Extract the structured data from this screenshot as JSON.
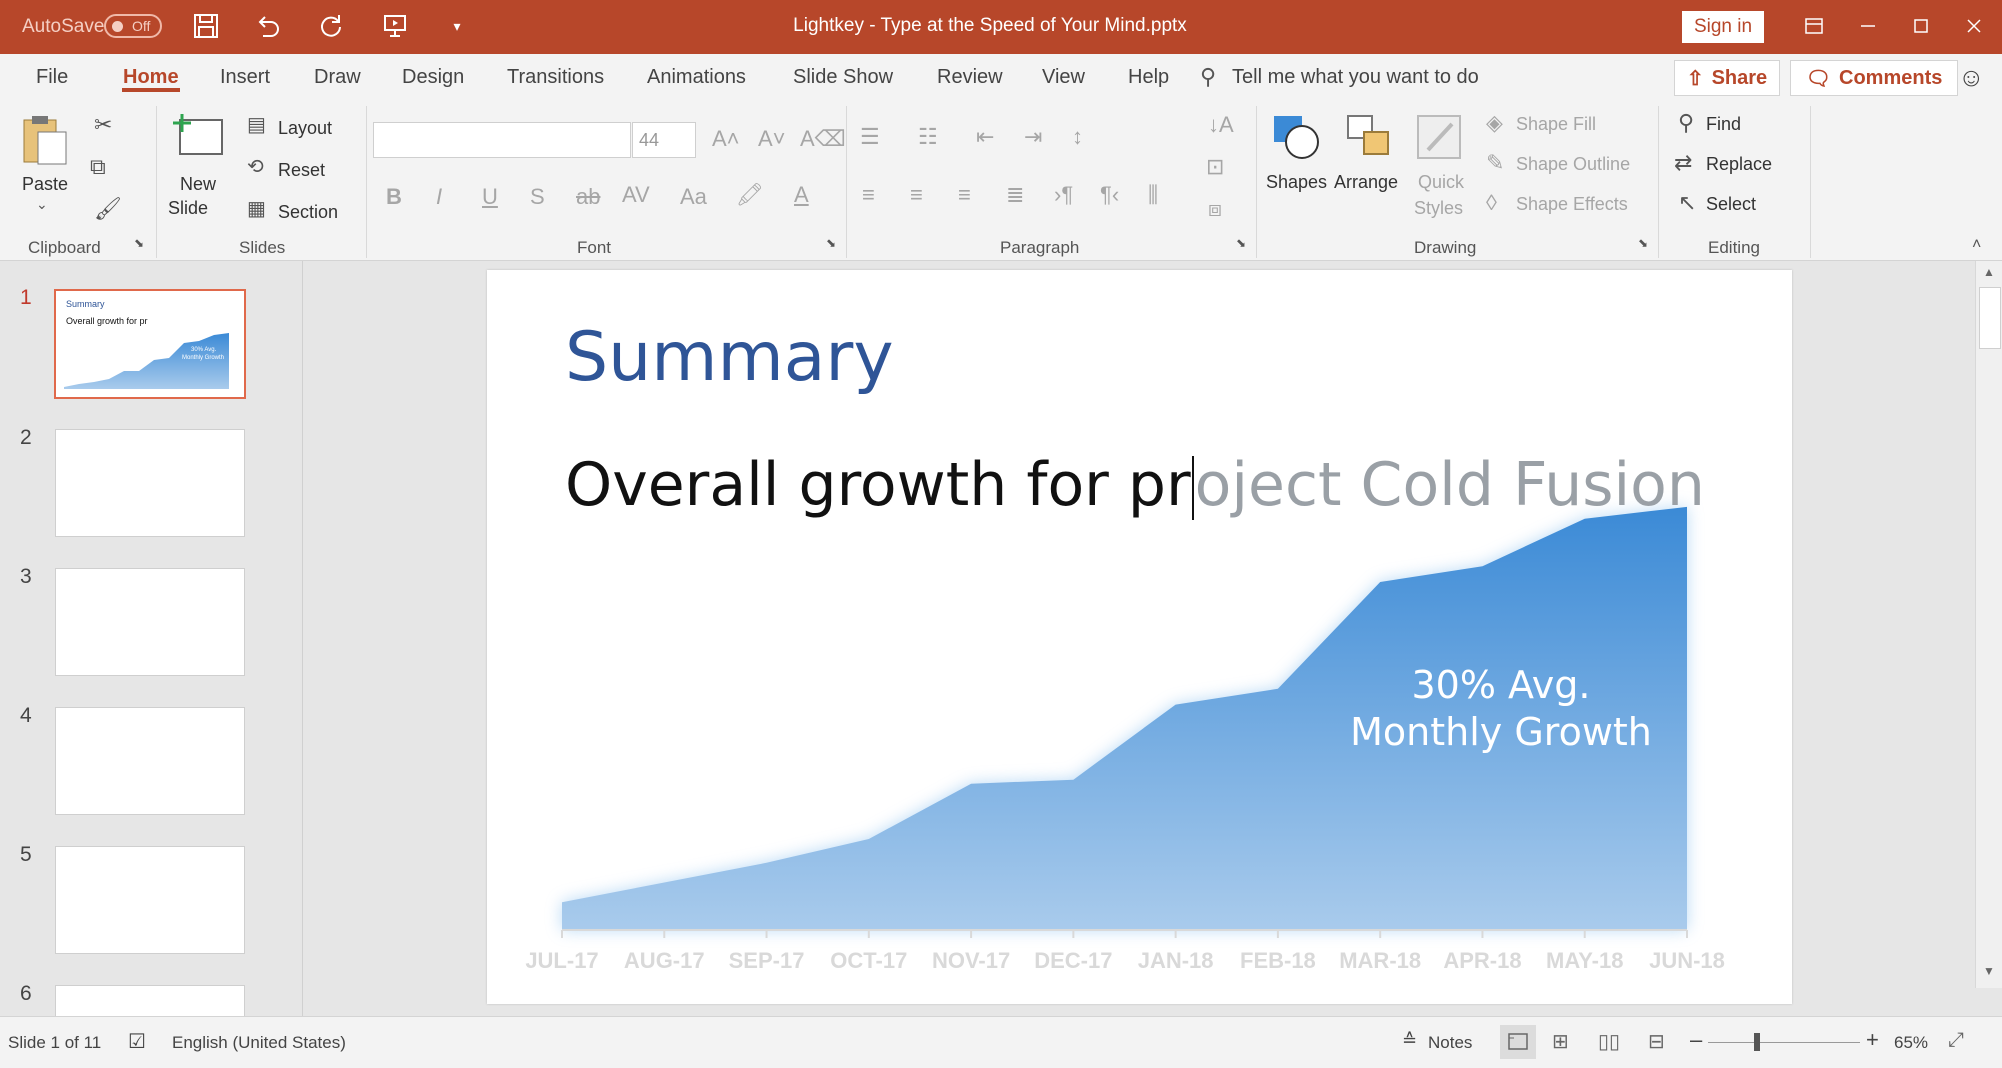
{
  "titlebar": {
    "autosave_label": "AutoSave",
    "autosave_state": "Off",
    "doc_title": "Lightkey - Type at the Speed of Your Mind.pptx",
    "sign_in": "Sign in"
  },
  "ribbon": {
    "tabs": [
      "File",
      "Home",
      "Insert",
      "Draw",
      "Design",
      "Transitions",
      "Animations",
      "Slide Show",
      "Review",
      "View",
      "Help"
    ],
    "active_tab": "Home",
    "tell_me": "Tell me what you want to do",
    "share": "Share",
    "comments": "Comments",
    "groups": {
      "clipboard": "Clipboard",
      "slides": "Slides",
      "font": "Font",
      "paragraph": "Paragraph",
      "drawing": "Drawing",
      "editing": "Editing"
    },
    "paste": "Paste",
    "new_slide_1": "New",
    "new_slide_2": "Slide",
    "layout": "Layout",
    "reset": "Reset",
    "section": "Section",
    "font_size": "44",
    "shapes": "Shapes",
    "arrange": "Arrange",
    "quick_styles_1": "Quick",
    "quick_styles_2": "Styles",
    "shape_fill": "Shape Fill",
    "shape_outline": "Shape Outline",
    "shape_effects": "Shape Effects",
    "find": "Find",
    "replace": "Replace",
    "select": "Select"
  },
  "thumbnails": {
    "numbers": [
      "1",
      "2",
      "3",
      "4",
      "5",
      "6"
    ],
    "t1_title": "Summary",
    "t1_sub": "Overall growth for pr",
    "t1_note_1": "30% Avg.",
    "t1_note_2": "Monthly Growth"
  },
  "slide": {
    "title": "Summary",
    "subtitle_typed": "Overall growth for pr",
    "subtitle_suggestion": "oject Cold Fusion",
    "chart_note_1": "30% Avg.",
    "chart_note_2": "Monthly Growth"
  },
  "chart_data": {
    "type": "area",
    "categories": [
      "JUL-17",
      "AUG-17",
      "SEP-17",
      "OCT-17",
      "NOV-17",
      "DEC-17",
      "JAN-18",
      "FEB-18",
      "MAR-18",
      "APR-18",
      "MAY-18",
      "JUN-18"
    ],
    "values": [
      7,
      12,
      17,
      23,
      37,
      38,
      57,
      61,
      88,
      92,
      104,
      107
    ],
    "ylim": [
      0,
      110
    ],
    "color": "#3b8ad6",
    "annotations": [
      "30% Avg.",
      "Monthly Growth"
    ]
  },
  "status": {
    "slide_of": "Slide 1 of 11",
    "language": "English (United States)",
    "notes": "Notes",
    "zoom": "65%"
  },
  "colors": {
    "accent": "#b7472a",
    "title_blue": "#2f5597",
    "chart_blue": "#3b8ad6"
  }
}
